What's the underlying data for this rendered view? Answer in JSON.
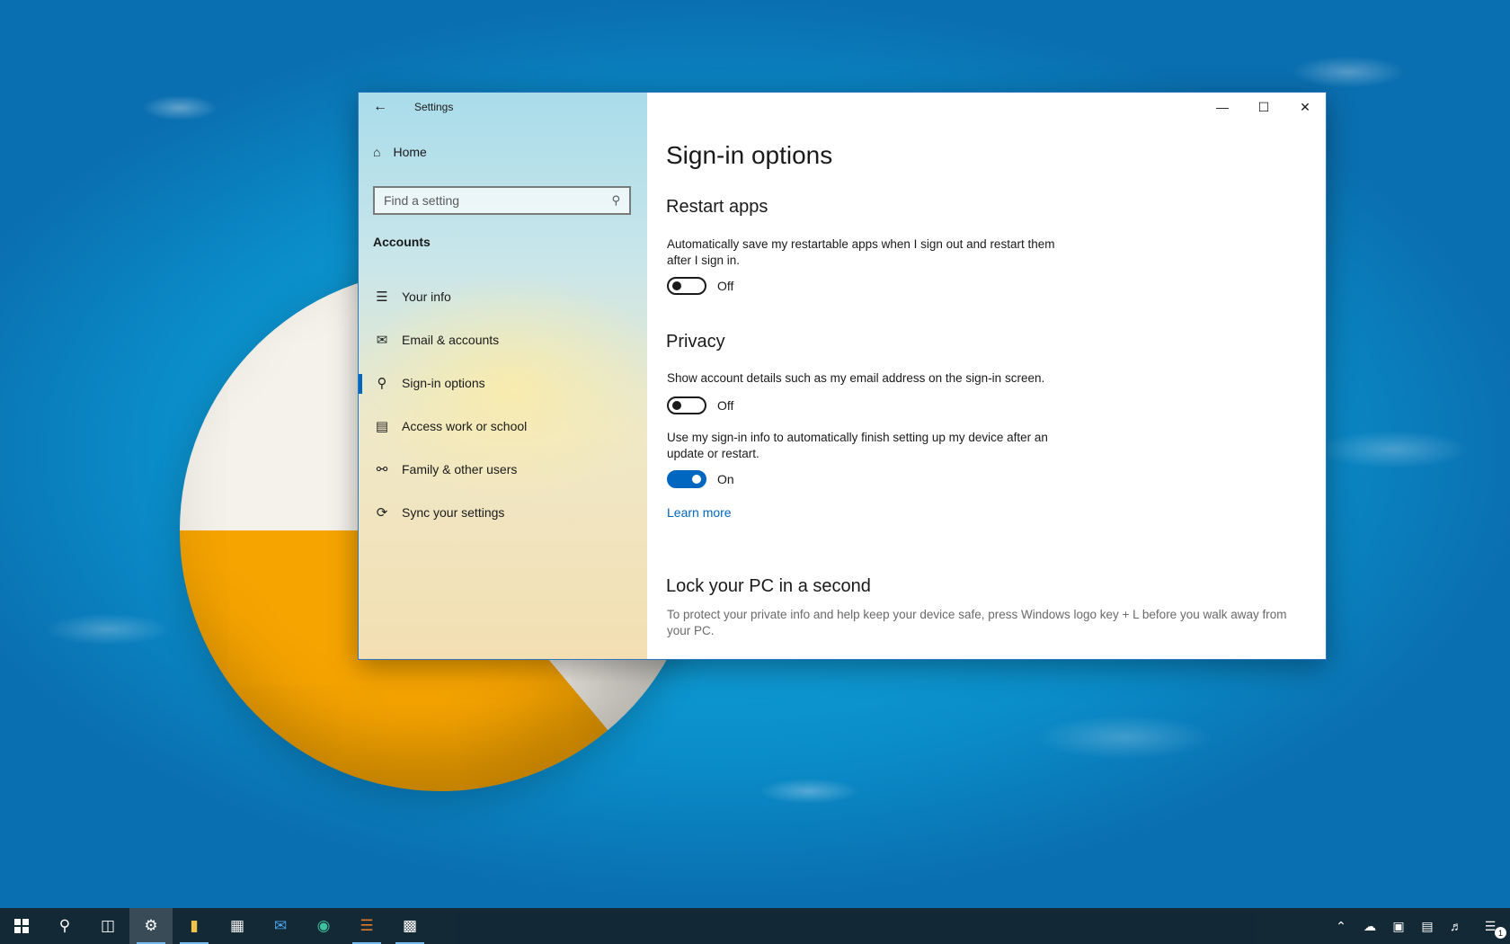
{
  "window": {
    "app_title": "Settings",
    "home_label": "Home",
    "search_placeholder": "Find a setting",
    "section_label": "Accounts",
    "nav_items": [
      {
        "label": "Your info",
        "icon": "person-card-icon"
      },
      {
        "label": "Email & accounts",
        "icon": "mail-icon"
      },
      {
        "label": "Sign-in options",
        "icon": "key-icon",
        "selected": true
      },
      {
        "label": "Access work or school",
        "icon": "briefcase-icon"
      },
      {
        "label": "Family & other users",
        "icon": "add-person-icon"
      },
      {
        "label": "Sync your settings",
        "icon": "sync-icon"
      }
    ]
  },
  "content": {
    "page_title": "Sign-in options",
    "restart_apps": {
      "heading": "Restart apps",
      "description": "Automatically save my restartable apps when I sign out and restart them after I sign in.",
      "toggle_state": "Off"
    },
    "privacy": {
      "heading": "Privacy",
      "setting1_description": "Show account details such as my email address on the sign-in screen.",
      "setting1_state": "Off",
      "setting2_description": "Use my sign-in info to automatically finish setting up my device after an update or restart.",
      "setting2_state": "On",
      "learn_more": "Learn more"
    },
    "lock_pc": {
      "heading": "Lock your PC in a second",
      "description": "To protect your private info and help keep your device safe, press Windows logo key + L before you walk away from your PC."
    }
  },
  "taskbar": {
    "notification_count": "1"
  },
  "colors": {
    "accent": "#0067c0",
    "window_border": "#2b79c2",
    "taskbar": "#121e28"
  }
}
